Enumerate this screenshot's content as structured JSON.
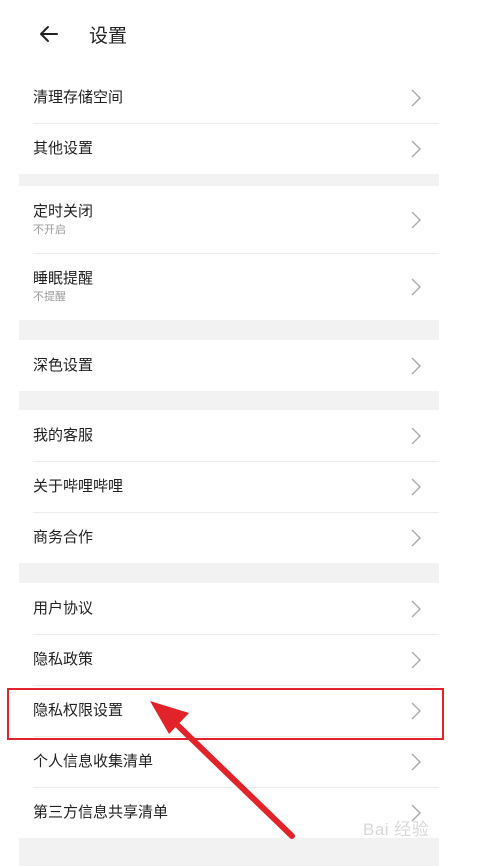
{
  "header": {
    "title": "设置",
    "back_icon": "arrow-left-icon"
  },
  "groups": [
    {
      "items": [
        {
          "label": "清理存储空间"
        },
        {
          "label": "其他设置"
        }
      ]
    },
    {
      "items": [
        {
          "label": "定时关闭",
          "sub": "不开启"
        },
        {
          "label": "睡眠提醒",
          "sub": "不提醒"
        }
      ]
    },
    {
      "items": [
        {
          "label": "深色设置"
        }
      ]
    },
    {
      "items": [
        {
          "label": "我的客服"
        },
        {
          "label": "关于哔哩哔哩"
        },
        {
          "label": "商务合作"
        }
      ]
    },
    {
      "items": [
        {
          "label": "用户协议"
        },
        {
          "label": "隐私政策"
        },
        {
          "label": "隐私权限设置"
        },
        {
          "label": "个人信息收集清单"
        },
        {
          "label": "第三方信息共享清单"
        }
      ]
    }
  ],
  "annotation": {
    "highlight_color": "#e2232a",
    "target": "隐私权限设置"
  },
  "watermark": {
    "text": "Bai 经验"
  },
  "icons": {
    "chevron": "chevron-right-icon"
  }
}
